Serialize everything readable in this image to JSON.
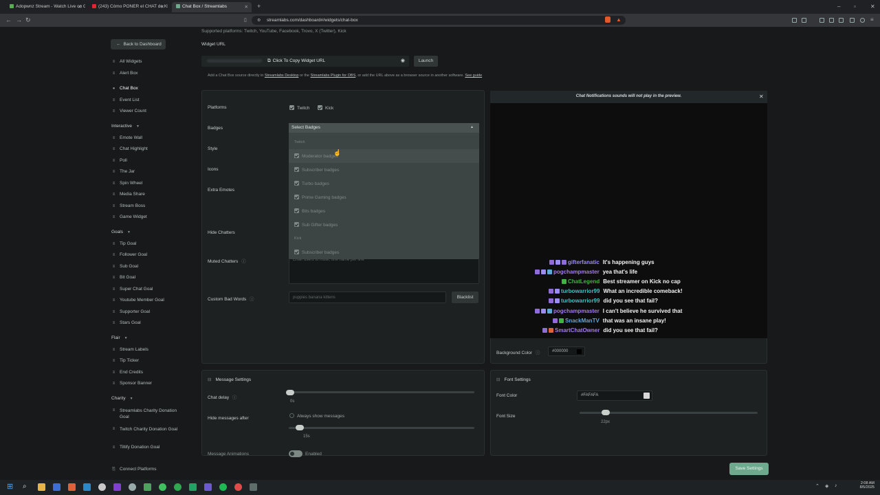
{
  "browser": {
    "tabs": [
      {
        "label": "Adopwnz Stream - Watch Live on Gr",
        "fav": "#55b04b"
      },
      {
        "label": "(243) Cómo PONER el CHAT de KICK",
        "fav": "#e2262b"
      },
      {
        "label": "Chat Box / Streamlabs",
        "fav": "#6ea98d"
      }
    ],
    "url": "streamlabs.com/dashboard#/widgets/chat-box"
  },
  "sidebar": {
    "back": "Back to Dashboard",
    "top_items": [
      "All Widgets",
      "Alert Box"
    ],
    "items_main": [
      "Chat Box",
      "Event List",
      "Viewer Count"
    ],
    "sections": [
      {
        "title": "Interactive",
        "items": [
          "Emote Wall",
          "Chat Highlight",
          "Poll",
          "The Jar",
          "Spin Wheel",
          "Media Share",
          "Stream Boss",
          "Game Widget"
        ]
      },
      {
        "title": "Goals",
        "items": [
          "Tip Goal",
          "Follower Goal",
          "Sub Goal",
          "Bit Goal",
          "Super Chat Goal",
          "Youtube Member Goal",
          "Supporter Goal",
          "Stars Goal"
        ]
      },
      {
        "title": "Flair",
        "items": [
          "Stream Labels",
          "Tip Ticker",
          "End Credits",
          "Sponsor Banner"
        ]
      },
      {
        "title": "Charity",
        "items": [
          "Streamlabs Charity Donation Goal",
          "Twitch Charity Donation Goal",
          "Tiltify Donation Goal"
        ]
      }
    ],
    "connect": "Connect Platforms"
  },
  "main": {
    "supported": "Supported platforms: Twitch, YouTube, Facebook, Trovo, X (Twitter), Kick",
    "widget_url_label": "Widget URL",
    "copy_url": "Click To Copy Widget URL",
    "launch": "Launch",
    "hint_prefix": "Add a Chat Box source directly in",
    "hint_link1": "Streamlabs Desktop",
    "hint_mid": "or the",
    "hint_link2": "Streamlabs Plugin for OBS",
    "hint_suffix": ", or add the URL above as a browser source in another software.",
    "hint_link3": "See guide",
    "platforms_label": "Platforms",
    "platform_twitch": "Twitch",
    "platform_kick": "Kick",
    "badges_label": "Badges",
    "style_label": "Style",
    "icons_label": "Icons",
    "extra_emotes_label": "Extra Emotes",
    "hide_chatters_label": "Hide Chatters",
    "muted_chatters_label": "Muted Chatters",
    "muted_placeholder": "Enter users to mute, one name per line",
    "bad_words_label": "Custom Bad Words",
    "bad_words_placeholder": "puppies banana kittens",
    "blacklist": "Blacklist"
  },
  "dropdown": {
    "placeholder": "Select Badges",
    "group_twitch": "Twitch",
    "twitch_options": [
      "Moderator badges",
      "Subscriber badges",
      "Turbo badges",
      "Prime Gaming badges",
      "Bits badges",
      "Sub Gifter badges"
    ],
    "group_kick": "Kick",
    "kick_options": [
      "Subscriber badges"
    ]
  },
  "preview": {
    "notice": "Chat Notifications sounds will not play in the preview.",
    "messages": [
      {
        "user": "gifterfanatic",
        "text": "It's happening guys",
        "color": "#9b8cf4",
        "badges": [
          "#8f6cd8",
          "#9b8cf4",
          "#8f6cd8"
        ]
      },
      {
        "user": "pogchampmaster",
        "text": "yea that's life",
        "color": "#a47de6",
        "badges": [
          "#8f6cd8",
          "#9b8cf4",
          "#5fa7d8"
        ]
      },
      {
        "user": "ChatLegend",
        "text": "Best streamer on Kick no cap",
        "color": "#43b244",
        "badges": [
          "#43b244"
        ]
      },
      {
        "user": "turbowarrior99",
        "text": "What an incredible comeback!",
        "color": "#3fc2c2",
        "badges": [
          "#8f6cd8",
          "#9b8cf4"
        ]
      },
      {
        "user": "turbowarrior99",
        "text": "did you see that fail?",
        "color": "#3fc2c2",
        "badges": [
          "#8f6cd8",
          "#9b8cf4"
        ]
      },
      {
        "user": "pogchampmaster",
        "text": "I can't believe he survived that",
        "color": "#a47de6",
        "badges": [
          "#8f6cd8",
          "#9b8cf4",
          "#5fa7d8"
        ]
      },
      {
        "user": "SnackManTV",
        "text": "that was an insane play!",
        "color": "#5fa7d8",
        "badges": [
          "#8f6cd8",
          "#43b244"
        ]
      },
      {
        "user": "SmartChatOwner",
        "text": "did you see that fail?",
        "color": "#a47de6",
        "badges": [
          "#8f6cd8",
          "#e0603a"
        ]
      }
    ],
    "bg_label": "Background Color",
    "bg_value": "#000000"
  },
  "message_settings": {
    "title": "Message Settings",
    "chat_delay_label": "Chat delay",
    "chat_delay_value": "0s",
    "chat_delay_fraction": 0,
    "hide_after_label": "Hide messages after",
    "always_show": "Always show messages",
    "hide_after_value": "15s",
    "hide_after_fraction": 0.05,
    "animations_label": "Message Animations",
    "animations_value": "Enabled"
  },
  "font_settings": {
    "title": "Font Settings",
    "font_color_label": "Font Color",
    "font_color_value": "#FAFAFA",
    "font_size_label": "Font Size",
    "font_size_value": "22px",
    "font_size_fraction": 0.14
  },
  "save": "Save Settings",
  "clock": {
    "time": "2:08 AM",
    "date": "8/5/2025"
  }
}
